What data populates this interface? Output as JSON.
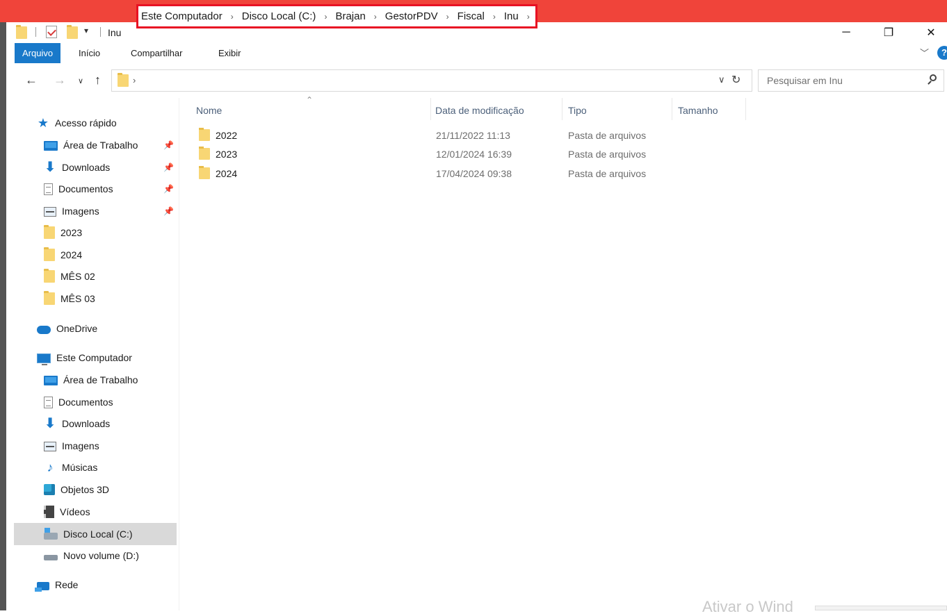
{
  "window": {
    "title": "Inu",
    "controls": {
      "minimize": "─",
      "maximize": "❐",
      "close": "✕"
    }
  },
  "ribbon": {
    "tabs": [
      {
        "label": "Arquivo",
        "active": true
      },
      {
        "label": "Início"
      },
      {
        "label": "Compartilhar"
      },
      {
        "label": "Exibir"
      }
    ],
    "help": "?"
  },
  "address": {
    "breadcrumbs": [
      "Este Computador",
      "Disco Local (C:)",
      "Brajan",
      "GestorPDV",
      "Fiscal",
      "Inu"
    ],
    "search_placeholder": "Pesquisar em Inu"
  },
  "nav": {
    "quick_access": "Acesso rápido",
    "quick_items": [
      {
        "label": "Área de Trabalho",
        "icon": "desktop-icon",
        "pinned": true
      },
      {
        "label": "Downloads",
        "icon": "download-icon",
        "pinned": true
      },
      {
        "label": "Documentos",
        "icon": "document-icon",
        "pinned": true
      },
      {
        "label": "Imagens",
        "icon": "image-icon",
        "pinned": true
      },
      {
        "label": "2023",
        "icon": "folder-icon"
      },
      {
        "label": "2024",
        "icon": "folder-icon"
      },
      {
        "label": "MÊS 02",
        "icon": "folder-icon"
      },
      {
        "label": "MÊS 03",
        "icon": "folder-icon"
      }
    ],
    "onedrive": "OneDrive",
    "this_pc": "Este Computador",
    "pc_items": [
      {
        "label": "Área de Trabalho",
        "icon": "desktop-icon"
      },
      {
        "label": "Documentos",
        "icon": "document-icon"
      },
      {
        "label": "Downloads",
        "icon": "download-icon"
      },
      {
        "label": "Imagens",
        "icon": "image-icon"
      },
      {
        "label": "Músicas",
        "icon": "music-icon"
      },
      {
        "label": "Objetos 3D",
        "icon": "cube-icon"
      },
      {
        "label": "Vídeos",
        "icon": "video-icon"
      },
      {
        "label": "Disco Local (C:)",
        "icon": "drive-icon",
        "selected": true
      },
      {
        "label": "Novo volume (D:)",
        "icon": "drive-icon"
      }
    ],
    "network": "Rede"
  },
  "content": {
    "columns": [
      "Nome",
      "Data de modificação",
      "Tipo",
      "Tamanho"
    ],
    "files": [
      {
        "name": "2022",
        "modified": "21/11/2022 11:13",
        "type": "Pasta de arquivos",
        "size": ""
      },
      {
        "name": "2023",
        "modified": "12/01/2024 16:39",
        "type": "Pasta de arquivos",
        "size": ""
      },
      {
        "name": "2024",
        "modified": "17/04/2024 09:38",
        "type": "Pasta de arquivos",
        "size": ""
      }
    ]
  },
  "watermark": "Ativar o Wind",
  "colors": {
    "accent": "#1979ca",
    "highlight_border": "#e81123",
    "top_banner": "#f0443a"
  }
}
